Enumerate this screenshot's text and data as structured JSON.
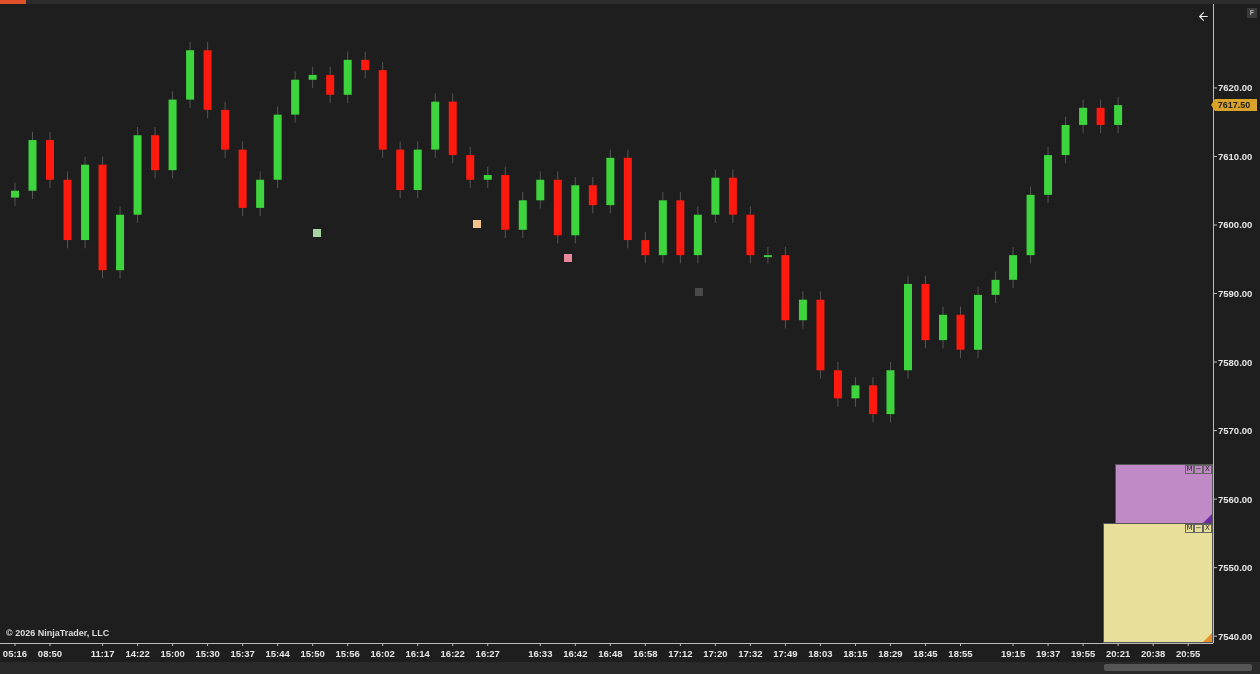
{
  "chart": {
    "chart_data": {
      "type": "candlestick",
      "ylim": [
        7539,
        7632.25
      ],
      "yticks": [
        {
          "value": 7620,
          "label": "7620.00"
        },
        {
          "value": 7610,
          "label": "7610.00"
        },
        {
          "value": 7600,
          "label": "7600.00"
        },
        {
          "value": 7590,
          "label": "7590.00"
        },
        {
          "value": 7580,
          "label": "7580.00"
        },
        {
          "value": 7570,
          "label": "7570.00"
        },
        {
          "value": 7560,
          "label": "7560.00"
        },
        {
          "value": 7550,
          "label": "7550.00"
        },
        {
          "value": 7540,
          "label": "7540.00"
        }
      ],
      "categories": [
        "05:16",
        null,
        "08:50",
        null,
        null,
        "11:17",
        null,
        "14:22",
        null,
        "15:00",
        null,
        "15:30",
        null,
        "15:37",
        null,
        "15:44",
        null,
        "15:50",
        null,
        "15:56",
        null,
        "16:02",
        null,
        "16:14",
        null,
        "16:22",
        null,
        "16:27",
        null,
        null,
        "16:33",
        null,
        "16:42",
        null,
        "16:48",
        null,
        "16:58",
        null,
        "17:12",
        null,
        "17:20",
        null,
        "17:32",
        null,
        "17:49",
        null,
        "18:03",
        null,
        "18:15",
        null,
        "18:29",
        null,
        "18:45",
        null,
        "18:55",
        null,
        null,
        "19:15",
        null,
        "19:37",
        null,
        "19:55",
        null,
        "20:21",
        null,
        "20:38",
        null,
        "20:55"
      ],
      "ohlc": [
        [
          7604,
          7606.2,
          7602.8,
          7605
        ],
        [
          7605,
          7613.6,
          7603.8,
          7612.4
        ],
        [
          7612.4,
          7613.6,
          7605.4,
          7606.6
        ],
        [
          7606.6,
          7607.8,
          7596.6,
          7597.8
        ],
        [
          7597.8,
          7610,
          7596.6,
          7608.8
        ],
        [
          7608.8,
          7610,
          7592.2,
          7593.4
        ],
        [
          7593.4,
          7602.7,
          7592.2,
          7601.5
        ],
        [
          7601.5,
          7614.3,
          7600.3,
          7613.1
        ],
        [
          7613.1,
          7614.3,
          7606.8,
          7608
        ],
        [
          7608,
          7619.5,
          7606.8,
          7618.3
        ],
        [
          7618.3,
          7626.7,
          7617.1,
          7625.5
        ],
        [
          7625.5,
          7626.7,
          7615.6,
          7616.8
        ],
        [
          7616.8,
          7618,
          7609.8,
          7611
        ],
        [
          7611,
          7612.2,
          7601.3,
          7602.5
        ],
        [
          7602.5,
          7607.8,
          7601.3,
          7606.6
        ],
        [
          7606.6,
          7617.3,
          7605.4,
          7616.1
        ],
        [
          7616.1,
          7622.4,
          7614.9,
          7621.2
        ],
        [
          7621.2,
          7623.1,
          7620,
          7621.9
        ],
        [
          7621.9,
          7623.1,
          7617.8,
          7619
        ],
        [
          7619,
          7625.3,
          7617.8,
          7624.1
        ],
        [
          7624.1,
          7625.3,
          7621.4,
          7622.6
        ],
        [
          7622.6,
          7623.8,
          7609.8,
          7611
        ],
        [
          7611,
          7612.2,
          7603.9,
          7605.1
        ],
        [
          7605.1,
          7612.2,
          7603.9,
          7611
        ],
        [
          7611,
          7619.2,
          7609.8,
          7618
        ],
        [
          7618,
          7619.2,
          7609,
          7610.2
        ],
        [
          7610.2,
          7611.4,
          7605.4,
          7606.6
        ],
        [
          7606.6,
          7608.5,
          7605.4,
          7607.3
        ],
        [
          7607.3,
          7608.5,
          7598.1,
          7599.3
        ],
        [
          7599.3,
          7604.8,
          7598.1,
          7603.6
        ],
        [
          7603.6,
          7607.8,
          7602.4,
          7606.6
        ],
        [
          7606.6,
          7607.8,
          7597.3,
          7598.5
        ],
        [
          7598.5,
          7607,
          7597.3,
          7605.8
        ],
        [
          7605.8,
          7607,
          7601.7,
          7602.9
        ],
        [
          7602.9,
          7611,
          7601.7,
          7609.8
        ],
        [
          7609.8,
          7611,
          7596.6,
          7597.8
        ],
        [
          7597.8,
          7599,
          7594.4,
          7595.6
        ],
        [
          7595.6,
          7604.8,
          7594.4,
          7603.6
        ],
        [
          7603.6,
          7604.8,
          7594.4,
          7595.6
        ],
        [
          7595.6,
          7602.7,
          7594.4,
          7601.5
        ],
        [
          7601.5,
          7608.1,
          7600.3,
          7606.9
        ],
        [
          7606.9,
          7608.1,
          7600.3,
          7601.5
        ],
        [
          7601.5,
          7602.7,
          7594.4,
          7595.6
        ],
        [
          7595.6,
          7596.8,
          7594.4,
          7595.6
        ],
        [
          7595.6,
          7596.8,
          7584.9,
          7586.1
        ],
        [
          7586.1,
          7590.3,
          7584.9,
          7589.1
        ],
        [
          7589.1,
          7590.3,
          7577.6,
          7578.8
        ],
        [
          7578.8,
          7580,
          7573.5,
          7574.7
        ],
        [
          7574.7,
          7577.8,
          7573.5,
          7576.6
        ],
        [
          7576.6,
          7577.8,
          7571.2,
          7572.4
        ],
        [
          7572.4,
          7580,
          7571.2,
          7578.8
        ],
        [
          7578.8,
          7592.6,
          7577.6,
          7591.4
        ],
        [
          7591.4,
          7592.6,
          7582,
          7583.2
        ],
        [
          7583.2,
          7588.1,
          7582,
          7586.9
        ],
        [
          7586.9,
          7588.1,
          7580.6,
          7581.8
        ],
        [
          7581.8,
          7591,
          7580.6,
          7589.8
        ],
        [
          7589.8,
          7593.2,
          7588.6,
          7592
        ],
        [
          7592,
          7596.8,
          7590.8,
          7595.6
        ],
        [
          7595.6,
          7605.6,
          7594.4,
          7604.4
        ],
        [
          7604.4,
          7611.4,
          7603.2,
          7610.2
        ],
        [
          7610.2,
          7615.8,
          7609,
          7614.6
        ],
        [
          7614.6,
          7618.3,
          7613.4,
          7617.1
        ],
        [
          7617.1,
          7618.3,
          7613.4,
          7614.6
        ],
        [
          7614.6,
          7618.7,
          7613.4,
          7617.5
        ],
        null,
        null,
        null,
        null
      ]
    },
    "markers": [
      {
        "color": "#a3d6a0"
      },
      {
        "color": "#f2c48a"
      },
      {
        "color": "#e9879f"
      },
      {
        "color": "#4a4a4a"
      }
    ],
    "last_price": "7617.50",
    "copyright": "© 2026 NinjaTrader, LLC",
    "corner_button": "F"
  },
  "notes": [
    {
      "color": "#c08ac6",
      "buttons": [
        "M",
        "−",
        "X"
      ]
    },
    {
      "color": "#e8e09a",
      "buttons": [
        "M",
        "−",
        "X"
      ]
    }
  ]
}
